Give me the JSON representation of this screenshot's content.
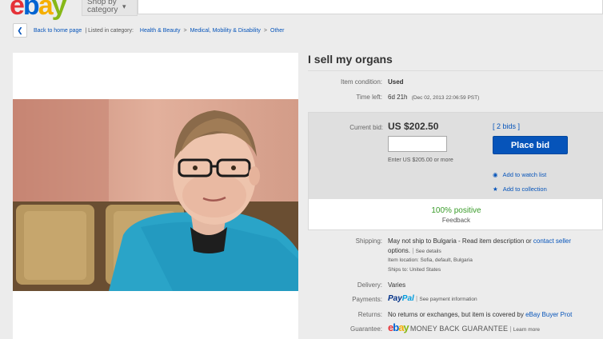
{
  "header": {
    "logo_letters": [
      "e",
      "b",
      "a",
      "y"
    ],
    "logo_colors": [
      "#e53238",
      "#0064d2",
      "#f5af02",
      "#86b817"
    ],
    "shop_by_category": "Shop by category"
  },
  "breadcrumb": {
    "back_label": "Back to home page",
    "listed_in": "| Listed in category:",
    "items": [
      "Health & Beauty",
      "Medical, Mobility & Disability",
      "Other"
    ],
    "separator": ">"
  },
  "listing": {
    "title": "I sell my organs",
    "condition_label": "Item condition:",
    "condition_value": "Used",
    "time_left_label": "Time left:",
    "time_left_value": "6d 21h",
    "time_left_date": "(Dec 02, 2013   22:06:59 PST)"
  },
  "bid": {
    "current_bid_label": "Current bid:",
    "current_bid_value": "US $202.50",
    "bids_link": "[ 2 bids ]",
    "input_value": "",
    "place_bid_label": "Place bid",
    "enter_note": "Enter US $205.00 or more",
    "watch_label": "Add to watch list",
    "collection_label": "Add to collection",
    "positive_label": "100% positive",
    "feedback_label": "Feedback"
  },
  "details": {
    "shipping_label": "Shipping:",
    "shipping_text": "May not ship to Bulgaria - Read item description or",
    "shipping_link": "contact seller",
    "options_text": "options.",
    "see_details": "See details",
    "item_location": "Item location:  Sofia, default, Bulgaria",
    "ships_to": "Ships to:  United States",
    "delivery_label": "Delivery:",
    "delivery_value": "Varies",
    "payments_label": "Payments:",
    "paypal_a": "Pay",
    "paypal_b": "Pal",
    "payment_info": "See payment information",
    "returns_label": "Returns:",
    "returns_text": "No returns or exchanges, but item is covered by",
    "returns_link": "eBay Buyer Prot",
    "guarantee_label": "Guarantee:",
    "guarantee_text": "MONEY BACK GUARANTEE",
    "learn_more": "Learn more"
  }
}
